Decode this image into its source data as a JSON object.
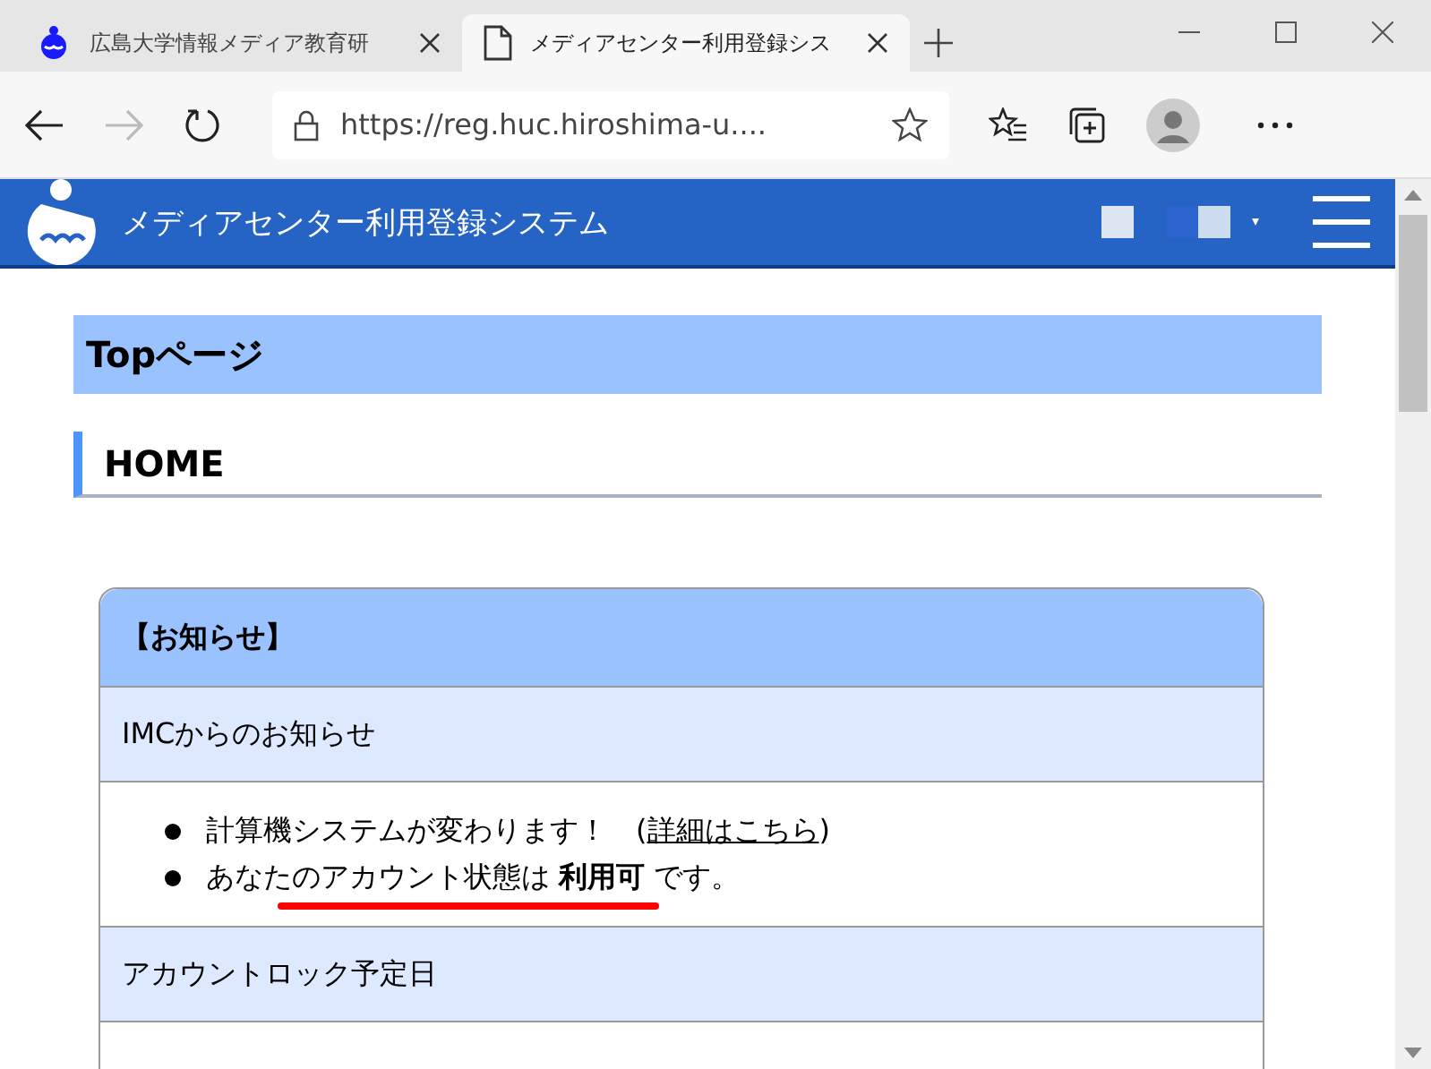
{
  "tabs": [
    {
      "title": "広島大学情報メディア教育研",
      "selected": false
    },
    {
      "title": "メディアセンター利用登録シス",
      "selected": true
    }
  ],
  "address_bar": {
    "url": "https://reg.huc.hiroshima-u...."
  },
  "site_header": {
    "title": "メディアセンター利用登録システム"
  },
  "page_title": "Topページ",
  "section_heading": "HOME",
  "notice_panel": {
    "title": "【お知らせ】",
    "rows": [
      {
        "kind": "heading",
        "text": "IMCからのお知らせ"
      },
      {
        "kind": "bullets",
        "items": [
          {
            "text": "計算機システムが変わります！　(",
            "link": "詳細はこちら",
            "after": ")"
          },
          {
            "text": "あなたのアカウント状態は **利用可** です。",
            "annotated": true
          }
        ]
      },
      {
        "kind": "heading",
        "text": "アカウントロック予定日"
      },
      {
        "kind": "empty"
      }
    ]
  }
}
